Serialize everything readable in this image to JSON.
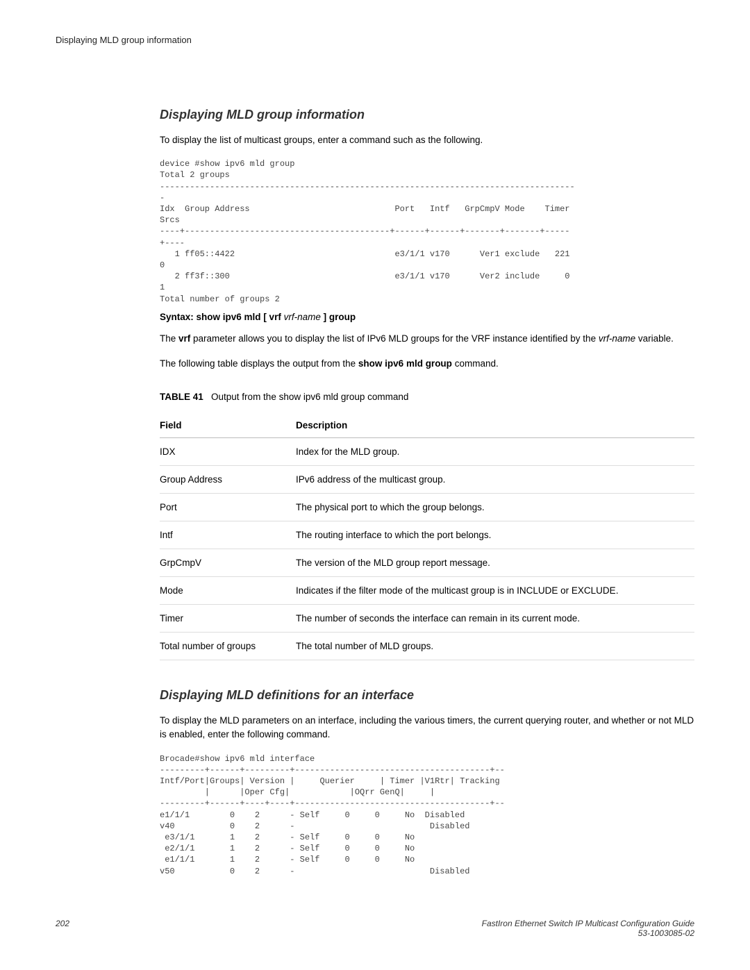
{
  "header": {
    "running": "Displaying MLD group information"
  },
  "section1": {
    "heading": "Displaying MLD group information",
    "intro": "To display the list of multicast groups, enter a command such as the following.",
    "cli": "device #show ipv6 mld group\nTotal 2 groups\n-----------------------------------------------------------------------------------\n-\nIdx  Group Address                             Port   Intf   GrpCmpV Mode    Timer  \nSrcs\n----+-----------------------------------------+------+------+-------+-------+-----\n+----\n   1 ff05::4422                                e3/1/1 v170      Ver1 exclude   221    \n0\n   2 ff3f::300                                 e3/1/1 v170      Ver2 include     0    \n1\nTotal number of groups 2",
    "syntax_prefix": "Syntax: show ipv6 mld",
    "syntax_vrf": "[ vrf",
    "syntax_varname": "vrf-name",
    "syntax_suffix": "] group",
    "para_vrf_1": "The ",
    "para_vrf_bold": "vrf",
    "para_vrf_2": " parameter allows you to display the list of IPv6 MLD groups for the VRF instance identified by the ",
    "para_vrf_italic": "vrf-name",
    "para_vrf_3": " variable.",
    "para_table_intro_1": "The following table displays the output from the ",
    "para_table_intro_bold": "show ipv6 mld group",
    "para_table_intro_2": " command."
  },
  "table41": {
    "label": "TABLE 41",
    "caption": "Output from the show ipv6 mld group command",
    "col_field": "Field",
    "col_desc": "Description",
    "rows": [
      {
        "field": "IDX",
        "desc": "Index for the MLD group."
      },
      {
        "field": "Group Address",
        "desc": "IPv6 address of the multicast group."
      },
      {
        "field": "Port",
        "desc": "The physical port to which the group belongs."
      },
      {
        "field": "Intf",
        "desc": "The routing interface to which the port belongs."
      },
      {
        "field": "GrpCmpV",
        "desc": "The version of the MLD group report message."
      },
      {
        "field": "Mode",
        "desc": "Indicates if the filter mode of the multicast group is in INCLUDE or EXCLUDE."
      },
      {
        "field": "Timer",
        "desc": "The number of seconds the interface can remain in its current mode."
      },
      {
        "field": "Total number of groups",
        "desc": "The total number of MLD groups."
      }
    ]
  },
  "section2": {
    "heading": "Displaying MLD definitions for an interface",
    "intro": "To display the MLD parameters on an interface, including the various timers, the current querying router, and whether or not MLD is enabled, enter the following command.",
    "cli": "Brocade#show ipv6 mld interface\n---------+------+---------+---------------------------------------+--\nIntf/Port|Groups| Version |     Querier     | Timer |V1Rtr| Tracking\n         |      |Oper Cfg|            |OQrr GenQ|     |\n---------+------+----+----+---------------------------------------+--\ne1/1/1        0    2      - Self     0     0     No  Disabled\nv40           0    2      -                           Disabled\n e3/1/1       1    2      - Self     0     0     No\n e2/1/1       1    2      - Self     0     0     No\n e1/1/1       1    2      - Self     0     0     No\nv50           0    2      -                           Disabled"
  },
  "footer": {
    "page": "202",
    "title": "FastIron Ethernet Switch IP Multicast Configuration Guide",
    "docnum": "53-1003085-02"
  }
}
